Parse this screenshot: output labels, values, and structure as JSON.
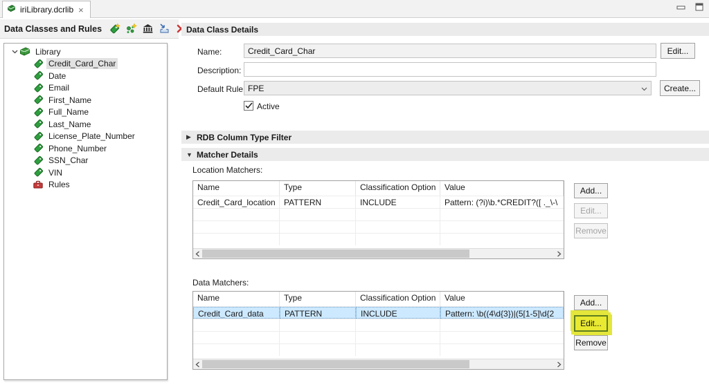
{
  "tab": {
    "title": "iriLibrary.dcrlib",
    "close_glyph": "×",
    "icon": "dcrlib-file-icon"
  },
  "window_controls": [
    {
      "name": "minimize-icon"
    },
    {
      "name": "maximize-icon"
    }
  ],
  "left_panel": {
    "header": "Data Classes and Rules",
    "toolbar_icons": [
      "new-data-class-icon",
      "new-data-class-group-icon",
      "library-icon",
      "import-icon",
      "delete-icon"
    ],
    "tree": {
      "root_label": "Library",
      "items": [
        "Credit_Card_Char",
        "Date",
        "Email",
        "First_Name",
        "Full_Name",
        "Last_Name",
        "License_Plate_Number",
        "Phone_Number",
        "SSN_Char",
        "VIN"
      ],
      "selected_item": "Credit_Card_Char",
      "rules_label": "Rules"
    }
  },
  "details": {
    "header": "Data Class Details",
    "name_label": "Name:",
    "name_value": "Credit_Card_Char",
    "edit_button": "Edit...",
    "description_label": "Description:",
    "description_value": "",
    "default_rule_label": "Default Rule:",
    "default_rule_value": "FPE",
    "create_button": "Create...",
    "active_label": "Active",
    "active_checked": true,
    "rdb_section": "RDB Column Type Filter",
    "matcher_section": "Matcher Details",
    "location_matchers": {
      "label": "Location Matchers:",
      "columns": [
        "Name",
        "Type",
        "Classification Option",
        "Value"
      ],
      "rows": [
        [
          "Credit_Card_location",
          "PATTERN",
          "INCLUDE",
          "Pattern: (?i)\\b.*CREDIT?([ ._\\-\\"
        ]
      ],
      "selected_row": -1,
      "empty_rows": 3,
      "buttons": [
        {
          "label": "Add...",
          "enabled": true,
          "highlighted": false
        },
        {
          "label": "Edit...",
          "enabled": false,
          "highlighted": false
        },
        {
          "label": "Remove",
          "enabled": false,
          "highlighted": false
        }
      ]
    },
    "data_matchers": {
      "label": "Data Matchers:",
      "columns": [
        "Name",
        "Type",
        "Classification Option",
        "Value"
      ],
      "rows": [
        [
          "Credit_Card_data",
          "PATTERN",
          "INCLUDE",
          "Pattern: \\b((4\\d{3})|(5[1-5]\\d{2"
        ]
      ],
      "selected_row": 0,
      "empty_rows": 3,
      "buttons": [
        {
          "label": "Add...",
          "enabled": true,
          "highlighted": false
        },
        {
          "label": "Edit...",
          "enabled": true,
          "highlighted": true
        },
        {
          "label": "Remove",
          "enabled": true,
          "highlighted": false
        }
      ]
    }
  },
  "colors": {
    "selection_blue": "#cde9ff",
    "highlight_yellow": "#e9e932",
    "highlight_border_green": "#5d7d1f",
    "section_bar_gray": "#ebebeb",
    "tree_selection_gray": "#e2e2e2",
    "tag_green": "#2f9e3f",
    "rules_red": "#c43b3b"
  }
}
